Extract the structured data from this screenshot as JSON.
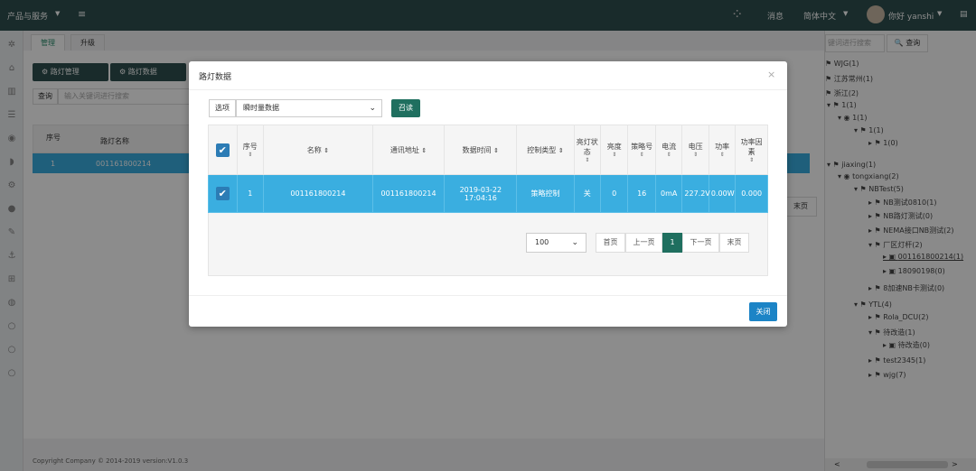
{
  "topbar": {
    "menu_label": "产品与服务",
    "messages": "消息",
    "language": "简体中文",
    "greeting": "你好 yanshi"
  },
  "main": {
    "tabs": [
      "管理",
      "升级"
    ],
    "buttons": [
      "路灯管理",
      "路灯数据"
    ],
    "search_label": "查询",
    "search_placeholder": "输入关键词进行搜索",
    "table_headers": [
      "序号",
      "路灯名称"
    ],
    "row": {
      "index": "1",
      "name": "001161800214"
    },
    "last_page": "末页",
    "copyright": "Copyright Company © 2014-2019 version:V1.0.3"
  },
  "modal": {
    "title": "路灯数据",
    "close_glyph": "×",
    "option_label": "选项",
    "option_selected": "瞬时量数据",
    "read_button": "召读",
    "headers": [
      "序号",
      "名称",
      "通讯地址",
      "数据时间",
      "控制类型",
      "亮灯状态",
      "亮度",
      "策略号",
      "电流",
      "电压",
      "功率",
      "功率因素"
    ],
    "row": {
      "index": "1",
      "name": "001161800214",
      "address": "001161800214",
      "date": "2019-03-22",
      "time": "17:04:16",
      "control_type": "策略控制",
      "light_state": "关",
      "brightness": "0",
      "strategy": "16",
      "current": "0mA",
      "voltage": "227.2V",
      "power": "0.00W",
      "power_factor": "0.000"
    },
    "page_size": "100",
    "pager": [
      "首页",
      "上一页",
      "1",
      "下一页",
      "末页"
    ],
    "close_button": "关闭"
  },
  "tree": {
    "search_placeholder": "键词进行搜索",
    "search_button": "查询",
    "items": [
      "WJG(1)",
      "江苏常州(1)",
      "浙江(2)",
      "1(1)",
      "1(1)",
      "1(1)",
      "1(0)",
      "jiaxing(1)",
      "tongxiang(2)",
      "NBTest(5)",
      "NB测试0810(1)",
      "NB路灯测试(0)",
      "NEMA接口NB测试(2)",
      "厂区灯杆(2)",
      "001161800214(1)",
      "18090198(0)",
      "8加速NB卡测试(0)",
      "YTL(4)",
      "Rola_DCU(2)",
      "待改造(1)",
      "待改造(0)",
      "test2345(1)",
      "wjg(7)"
    ]
  }
}
